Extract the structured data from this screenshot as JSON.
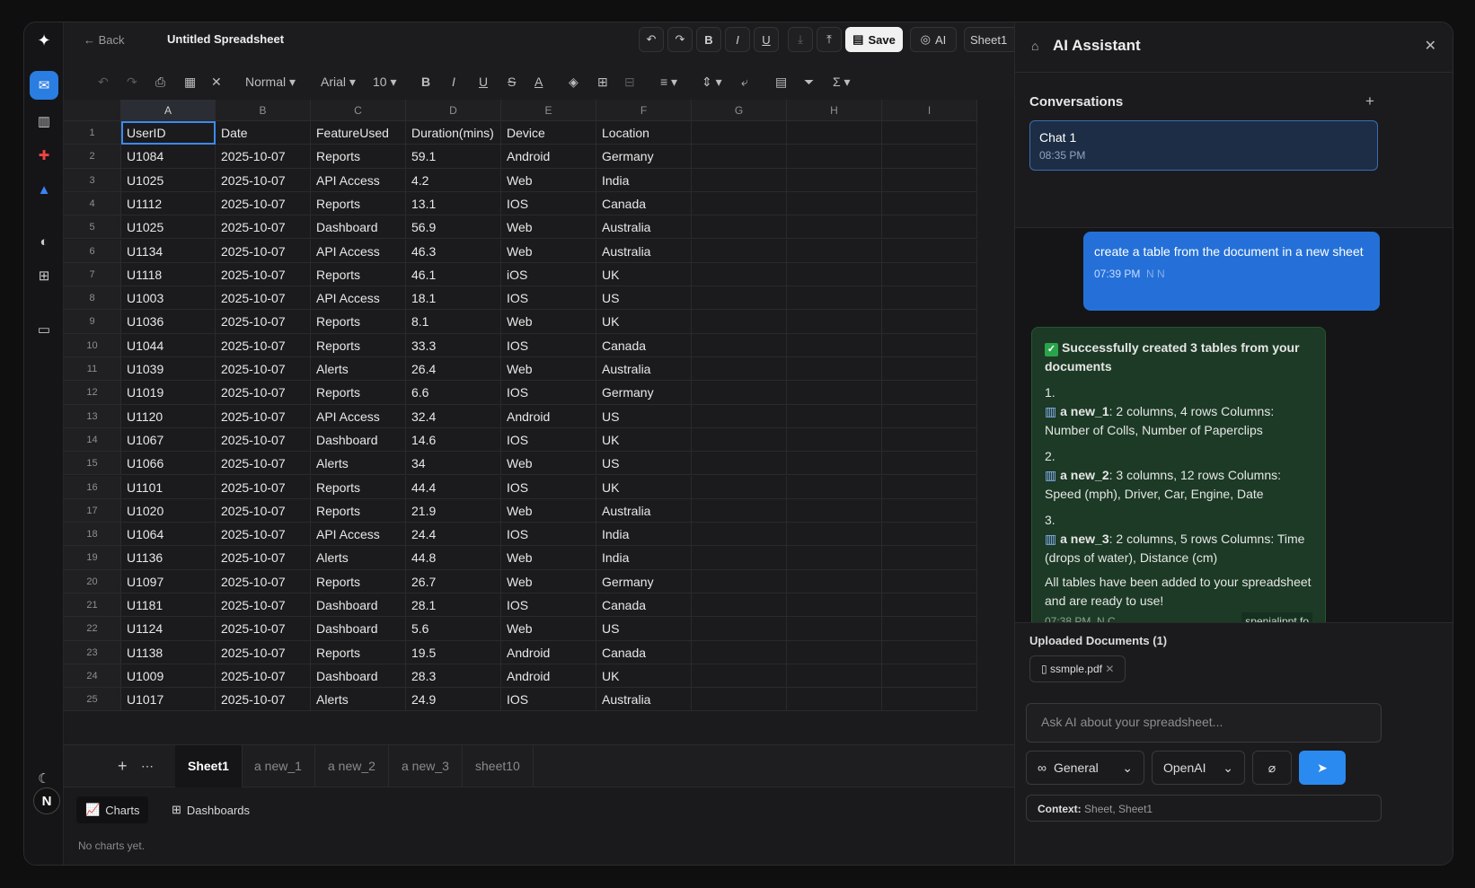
{
  "header": {
    "back_label": "Back",
    "title": "Untitled Spreadsheet",
    "buttons": {
      "undo": "↶",
      "redo": "↷",
      "bold": "B",
      "italic": "I",
      "underline": "U",
      "save": "Save",
      "ai": "AI",
      "sheet": "Sheet1"
    }
  },
  "toolbar": {
    "style": "Normal",
    "font": "Arial",
    "size": "10"
  },
  "grid": {
    "columns": [
      "A",
      "B",
      "C",
      "D",
      "E",
      "F",
      "G",
      "H",
      "I"
    ],
    "rows": [
      [
        "UserID",
        "Date",
        "FeatureUsed",
        "Duration(mins)",
        "Device",
        "Location"
      ],
      [
        "U1084",
        "2025-10-07",
        "Reports",
        "59.1",
        "Android",
        "Germany"
      ],
      [
        "U1025",
        "2025-10-07",
        "API Access",
        "4.2",
        "Web",
        "India"
      ],
      [
        "U1112",
        "2025-10-07",
        "Reports",
        "13.1",
        "IOS",
        "Canada"
      ],
      [
        "U1025",
        "2025-10-07",
        "Dashboard",
        "56.9",
        "Web",
        "Australia"
      ],
      [
        "U1134",
        "2025-10-07",
        "API Access",
        "46.3",
        "Web",
        "Australia"
      ],
      [
        "U1118",
        "2025-10-07",
        "Reports",
        "46.1",
        "iOS",
        "UK"
      ],
      [
        "U1003",
        "2025-10-07",
        "API Access",
        "18.1",
        "IOS",
        "US"
      ],
      [
        "U1036",
        "2025-10-07",
        "Reports",
        "8.1",
        "Web",
        "UK"
      ],
      [
        "U1044",
        "2025-10-07",
        "Reports",
        "33.3",
        "IOS",
        "Canada"
      ],
      [
        "U1039",
        "2025-10-07",
        "Alerts",
        "26.4",
        "Web",
        "Australia"
      ],
      [
        "U1019",
        "2025-10-07",
        "Reports",
        "6.6",
        "IOS",
        "Germany"
      ],
      [
        "U1120",
        "2025-10-07",
        "API Access",
        "32.4",
        "Android",
        "US"
      ],
      [
        "U1067",
        "2025-10-07",
        "Dashboard",
        "14.6",
        "IOS",
        "UK"
      ],
      [
        "U1066",
        "2025-10-07",
        "Alerts",
        "34",
        "Web",
        "US"
      ],
      [
        "U1101",
        "2025-10-07",
        "Reports",
        "44.4",
        "IOS",
        "UK"
      ],
      [
        "U1020",
        "2025-10-07",
        "Reports",
        "21.9",
        "Web",
        "Australia"
      ],
      [
        "U1064",
        "2025-10-07",
        "API Access",
        "24.4",
        "IOS",
        "India"
      ],
      [
        "U1136",
        "2025-10-07",
        "Alerts",
        "44.8",
        "Web",
        "India"
      ],
      [
        "U1097",
        "2025-10-07",
        "Reports",
        "26.7",
        "Web",
        "Germany"
      ],
      [
        "U1181",
        "2025-10-07",
        "Dashboard",
        "28.1",
        "IOS",
        "Canada"
      ],
      [
        "U1124",
        "2025-10-07",
        "Dashboard",
        "5.6",
        "Web",
        "US"
      ],
      [
        "U1138",
        "2025-10-07",
        "Reports",
        "19.5",
        "Android",
        "Canada"
      ],
      [
        "U1009",
        "2025-10-07",
        "Dashboard",
        "28.3",
        "Android",
        "UK"
      ],
      [
        "U1017",
        "2025-10-07",
        "Alerts",
        "24.9",
        "IOS",
        "Australia"
      ]
    ]
  },
  "sheet_tabs": [
    "Sheet1",
    "a new_1",
    "a new_2",
    "a new_3",
    "sheet10"
  ],
  "bottom": {
    "charts": "Charts",
    "dashboards": "Dashboards",
    "empty": "No charts yet."
  },
  "ai": {
    "title": "AI Assistant",
    "conversations_label": "Conversations",
    "chat": {
      "name": "Chat 1",
      "time": "08:35 PM"
    },
    "user_message": {
      "text": "create a table from the document in a new sheet",
      "time": "07:39 PM",
      "initials": "N N"
    },
    "bot_message": {
      "headline": "Successfully created 3 tables from your documents",
      "items": [
        {
          "num": "1.",
          "name": "a new_1",
          "desc": ": 2 columns, 4 rows Columns: Number of Colls, Number of Paperclips"
        },
        {
          "num": "2.",
          "name": "a new_2",
          "desc": ": 3 columns, 12 rows Columns: Speed (mph), Driver, Car, Engine, Date"
        },
        {
          "num": "3.",
          "name": "a new_3",
          "desc": ": 2 columns, 5 rows Columns: Time (drops of water), Distance (cm)"
        }
      ],
      "footer": "All tables have been added to your spreadsheet and are ready to use!",
      "time": "07:38 PM",
      "initials": "N.C",
      "tag": "spenialippt.fo"
    },
    "uploads_label": "Uploaded Documents (1)",
    "upload_file": "ssmple.pdf",
    "input_placeholder": "Ask AI about your spreadsheet...",
    "mode": "General",
    "provider": "OpenAI",
    "context_label": "Context:",
    "context_value": "Sheet, Sheet1"
  },
  "user_avatar": "N",
  "colors": {
    "accent": "#2a7de1",
    "bot_bg": "#1c3a25",
    "user_bg": "#2470d8"
  }
}
